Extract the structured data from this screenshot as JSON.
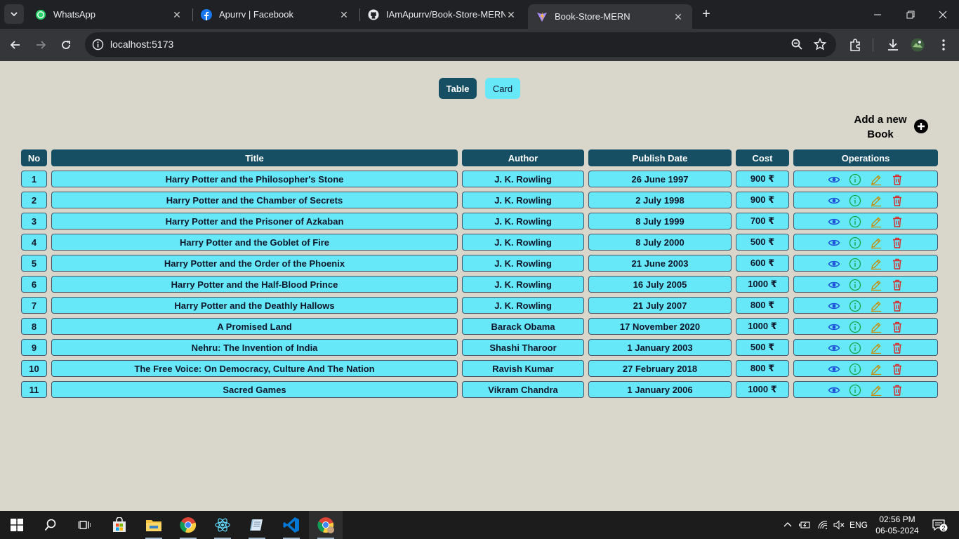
{
  "browser": {
    "tabs": [
      {
        "title": "WhatsApp",
        "icon": "whatsapp-icon"
      },
      {
        "title": "Apurrv | Facebook",
        "icon": "facebook-icon"
      },
      {
        "title": "IAmApurrv/Book-Store-MERN",
        "icon": "github-icon"
      },
      {
        "title": "Book-Store-MERN",
        "icon": "vite-icon",
        "active": true
      }
    ],
    "url": "localhost:5173"
  },
  "view_toggle": {
    "table_label": "Table",
    "card_label": "Card",
    "selected": "Table"
  },
  "add_book": {
    "label_line1": "Add a new",
    "label_line2": "Book"
  },
  "table": {
    "headers": {
      "no": "No",
      "title": "Title",
      "author": "Author",
      "publish_date": "Publish Date",
      "cost": "Cost",
      "operations": "Operations"
    },
    "operations_icons": [
      "eye-icon",
      "info-icon",
      "edit-icon",
      "delete-icon"
    ],
    "rows": [
      {
        "no": "1",
        "title": "Harry Potter and the Philosopher's Stone",
        "author": "J. K. Rowling",
        "publish_date": "26 June 1997",
        "cost": "900 ₹"
      },
      {
        "no": "2",
        "title": "Harry Potter and the Chamber of Secrets",
        "author": "J. K. Rowling",
        "publish_date": "2 July 1998",
        "cost": "900 ₹"
      },
      {
        "no": "3",
        "title": "Harry Potter and the Prisoner of Azkaban",
        "author": "J. K. Rowling",
        "publish_date": "8 July 1999",
        "cost": "700 ₹"
      },
      {
        "no": "4",
        "title": "Harry Potter and the Goblet of Fire",
        "author": "J. K. Rowling",
        "publish_date": "8 July 2000",
        "cost": "500 ₹"
      },
      {
        "no": "5",
        "title": "Harry Potter and the Order of the Phoenix",
        "author": "J. K. Rowling",
        "publish_date": "21 June 2003",
        "cost": "600 ₹"
      },
      {
        "no": "6",
        "title": "Harry Potter and the Half-Blood Prince",
        "author": "J. K. Rowling",
        "publish_date": "16 July 2005",
        "cost": "1000 ₹"
      },
      {
        "no": "7",
        "title": "Harry Potter and the Deathly Hallows",
        "author": "J. K. Rowling",
        "publish_date": "21 July 2007",
        "cost": "800 ₹"
      },
      {
        "no": "8",
        "title": "A Promised Land",
        "author": "Barack Obama",
        "publish_date": "17 November 2020",
        "cost": "1000 ₹"
      },
      {
        "no": "9",
        "title": "Nehru: The Invention of India",
        "author": "Shashi Tharoor",
        "publish_date": "1 January 2003",
        "cost": "500 ₹"
      },
      {
        "no": "10",
        "title": "The Free Voice: On Democracy, Culture And The Nation",
        "author": "Ravish Kumar",
        "publish_date": "27 February 2018",
        "cost": "800 ₹"
      },
      {
        "no": "11",
        "title": "Sacred Games",
        "author": "Vikram Chandra",
        "publish_date": "1 January 2006",
        "cost": "1000 ₹"
      }
    ]
  },
  "taskbar": {
    "apps": [
      "windows-start-icon",
      "search-icon",
      "task-view-icon",
      "microsoft-store-icon",
      "file-explorer-icon",
      "chrome-icon",
      "react-icon",
      "notepad-icon",
      "vscode-icon",
      "chrome-profile-icon"
    ],
    "language": "ENG",
    "time": "02:56 PM",
    "date": "06-05-2024",
    "notification_count": "2"
  },
  "colors": {
    "page_bg": "#d9d6cb",
    "header_bg": "#164e63",
    "cell_bg": "#67e8f9",
    "eye": "#1d4ed8",
    "info": "#16a34a",
    "edit": "#ca8a04",
    "delete": "#dc2626"
  }
}
